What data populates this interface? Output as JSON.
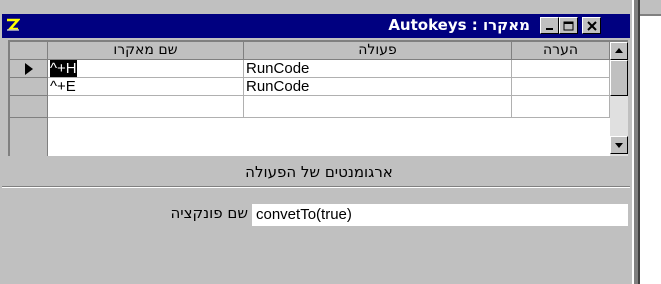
{
  "window": {
    "title": "Autokeys : מאקרו"
  },
  "grid": {
    "headers": {
      "macro_name": "שם מאקרו",
      "action": "פעולה",
      "comment": "הערה"
    },
    "rows": [
      {
        "macro_name": "^+H",
        "action": "RunCode",
        "comment": "",
        "current": true
      },
      {
        "macro_name": "^+E",
        "action": "RunCode",
        "comment": "",
        "current": false
      },
      {
        "macro_name": "",
        "action": "",
        "comment": "",
        "current": false
      }
    ]
  },
  "arguments": {
    "section_label": "ארגומנטים של הפעולה",
    "function_name_label": "שם פונקציה",
    "function_name_value": "convetTo(true)"
  },
  "icons": {
    "app": "access-macro-icon",
    "minimize": "minimize-icon",
    "maximize": "maximize-icon",
    "close": "close-icon",
    "row_pointer": "current-record-arrow-icon",
    "scroll_up": "arrow-up-icon",
    "scroll_down": "arrow-down-icon"
  },
  "colors": {
    "titlebar": "#000080",
    "face": "#c0c0c0",
    "selection": "#000000"
  }
}
